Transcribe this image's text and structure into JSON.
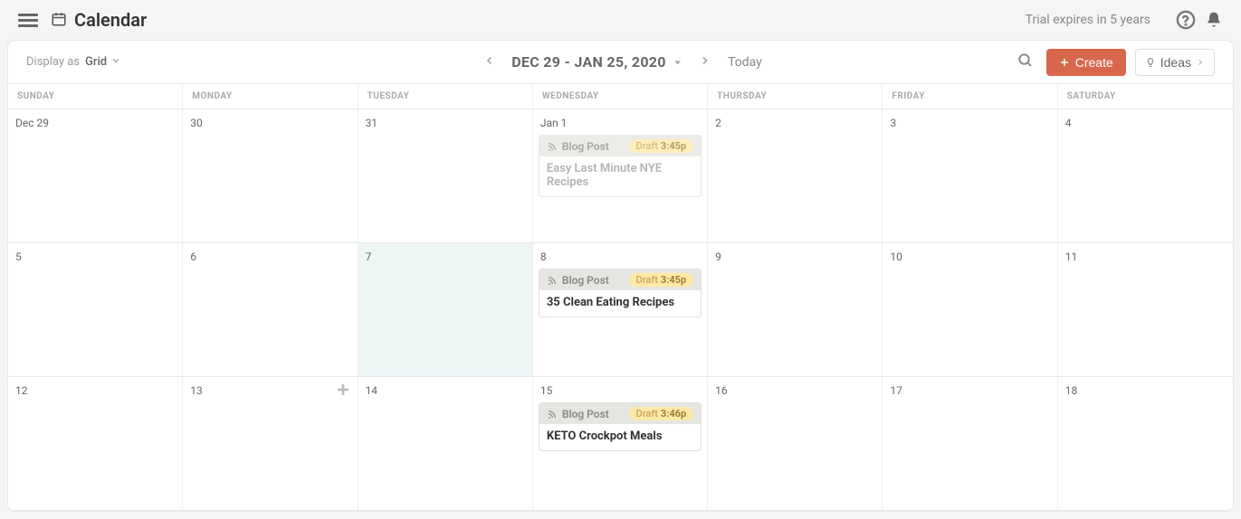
{
  "header": {
    "title": "Calendar",
    "trial_text": "Trial expires in 5 years"
  },
  "toolbar": {
    "display_as_label": "Display as",
    "display_value": "Grid",
    "date_range": "DEC 29 - JAN 25, 2020",
    "today_label": "Today",
    "create_label": "Create",
    "ideas_label": "Ideas"
  },
  "day_headers": [
    "SUNDAY",
    "MONDAY",
    "TUESDAY",
    "WEDNESDAY",
    "THURSDAY",
    "FRIDAY",
    "SATURDAY"
  ],
  "weeks": [
    {
      "days": [
        "Dec 29",
        "30",
        "31",
        "Jan 1",
        "2",
        "3",
        "4"
      ],
      "today_index": -1,
      "hover_add_index": -1,
      "events": {
        "3": {
          "type": "Blog Post",
          "status": "Draft",
          "time": "3:45p",
          "title": "Easy Last Minute NYE Recipes",
          "dim": true
        }
      }
    },
    {
      "days": [
        "5",
        "6",
        "7",
        "8",
        "9",
        "10",
        "11"
      ],
      "today_index": 2,
      "hover_add_index": -1,
      "events": {
        "3": {
          "type": "Blog Post",
          "status": "Draft",
          "time": "3:45p",
          "title": "35 Clean Eating Recipes",
          "dim": false
        }
      }
    },
    {
      "days": [
        "12",
        "13",
        "14",
        "15",
        "16",
        "17",
        "18"
      ],
      "today_index": -1,
      "hover_add_index": 1,
      "events": {
        "3": {
          "type": "Blog Post",
          "status": "Draft",
          "time": "3:46p",
          "title": "KETO Crockpot Meals",
          "dim": false
        }
      }
    }
  ]
}
